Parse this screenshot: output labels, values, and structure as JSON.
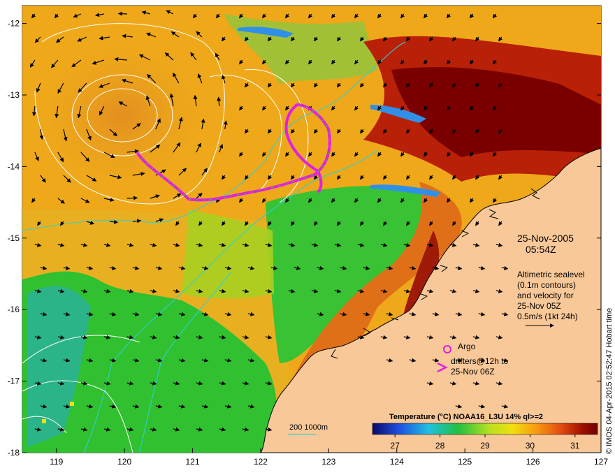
{
  "map": {
    "colors": {
      "land": "#f8c898",
      "coast": "#000000",
      "sst_low": "#2050c8",
      "sst_mid": "#22c03a",
      "sst_high": "#8c0000",
      "contour": "#ffffff",
      "bathymetry": "#30d0d0",
      "drifter": "#e020e0",
      "vector": "#000000"
    },
    "x_ticks": [
      "119",
      "120",
      "121",
      "122",
      "123",
      "124",
      "125",
      "126",
      "127"
    ],
    "y_ticks": [
      "-12",
      "-13",
      "-14",
      "-15",
      "-16",
      "-17",
      "-18"
    ],
    "icons": [
      "velocity-arrow-icon",
      "argo-circle-icon",
      "drifter-chevron-icon",
      "bathymetry-line-icon"
    ]
  },
  "annotations": {
    "date": "25-Nov-2005",
    "time": "05:54Z",
    "altimetry": [
      "Altimetric sealevel",
      "(0.1m contours)",
      "and velocity for",
      "25-Nov 05Z",
      "0.5m/s (1kt 24h)"
    ],
    "argo": "Argo",
    "drifters": [
      "drifters@12h to",
      "25-Nov 06Z"
    ],
    "bathymetry": "200  1000m"
  },
  "colorbar": {
    "title": "Temperature (°C) NOAA16_L3U 14% ql>=2",
    "ticks": [
      "27",
      "28",
      "29",
      "30",
      "31"
    ],
    "range": [
      26.5,
      31.5
    ]
  },
  "credit": "© IMOS 04-Apr-2015 02:52:47 Hobart time"
}
